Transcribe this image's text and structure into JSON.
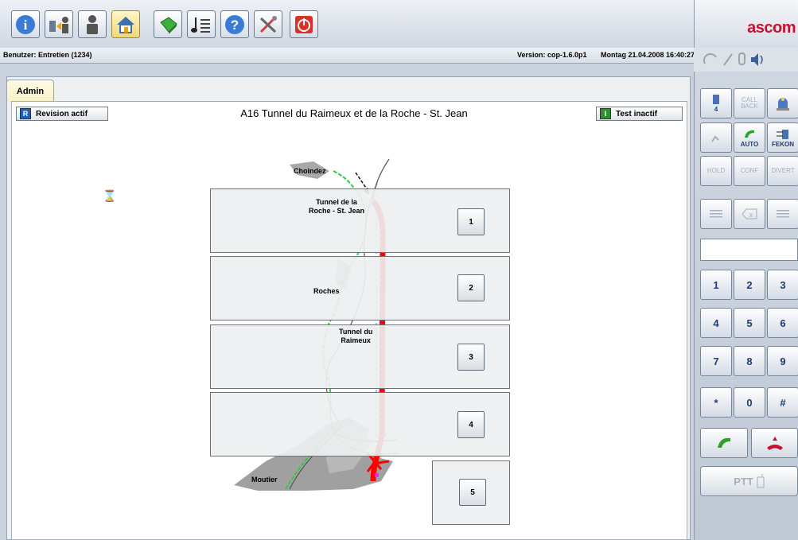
{
  "header": {
    "brand": "ascom",
    "user_label": "Benutzer: Entretien (1234)",
    "version": "Version: cop-1.6.0p1",
    "datetime": "Montag 21.04.2008 16:40:27"
  },
  "toolbar": {
    "icons": [
      "info-icon",
      "login-icon",
      "person-icon",
      "home-icon",
      "book-icon",
      "music-list-icon",
      "help-icon",
      "tools-icon",
      "power-icon"
    ],
    "active": "home-icon"
  },
  "tabs": [
    {
      "label": "Admin",
      "active": true
    }
  ],
  "page": {
    "title": "A16 Tunnel du Raimeux et de la Roche - St. Jean",
    "revision_label": "Revision actif",
    "revision_badge": "R",
    "test_label": "Test inactif",
    "test_badge": "I"
  },
  "map": {
    "labels": {
      "choindez": "Choindez",
      "tunnel_roche": "Tunnel de la\nRoche - St. Jean",
      "roches": "Roches",
      "tunnel_raimeux": "Tunnel du\nRaimeux",
      "moutier": "Moutier"
    },
    "sectors": [
      "1",
      "2",
      "3",
      "4",
      "5"
    ]
  },
  "phone": {
    "top_buttons": [
      "4",
      "CALL BACK",
      ""
    ],
    "row2": [
      "",
      "AUTO",
      "FEKON"
    ],
    "row3": [
      "HOLD",
      "CONF",
      "DIVERT"
    ],
    "keys": [
      "1",
      "2",
      "3",
      "4",
      "5",
      "6",
      "7",
      "8",
      "9",
      "*",
      "0",
      "#"
    ],
    "ptt_label": "PTT"
  },
  "colors": {
    "brand": "#c8102e",
    "route": "#ff0000",
    "rail": "#22cc22",
    "terrain": "#9a9a9a"
  }
}
